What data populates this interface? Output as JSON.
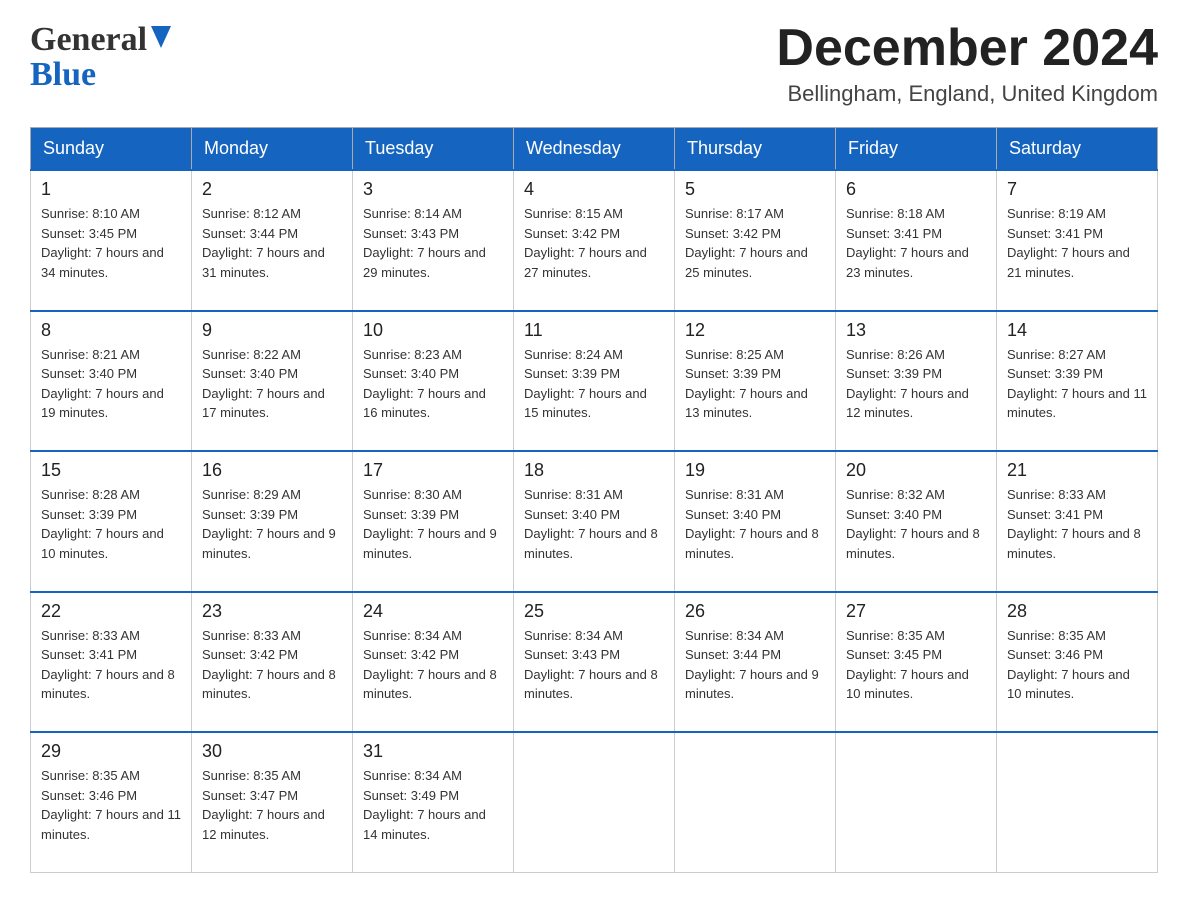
{
  "header": {
    "logo_line1": "General",
    "logo_line2": "Blue",
    "month_title": "December 2024",
    "location": "Bellingham, England, United Kingdom"
  },
  "weekdays": [
    "Sunday",
    "Monday",
    "Tuesday",
    "Wednesday",
    "Thursday",
    "Friday",
    "Saturday"
  ],
  "weeks": [
    [
      {
        "day": "1",
        "sunrise": "8:10 AM",
        "sunset": "3:45 PM",
        "daylight": "7 hours and 34 minutes."
      },
      {
        "day": "2",
        "sunrise": "8:12 AM",
        "sunset": "3:44 PM",
        "daylight": "7 hours and 31 minutes."
      },
      {
        "day": "3",
        "sunrise": "8:14 AM",
        "sunset": "3:43 PM",
        "daylight": "7 hours and 29 minutes."
      },
      {
        "day": "4",
        "sunrise": "8:15 AM",
        "sunset": "3:42 PM",
        "daylight": "7 hours and 27 minutes."
      },
      {
        "day": "5",
        "sunrise": "8:17 AM",
        "sunset": "3:42 PM",
        "daylight": "7 hours and 25 minutes."
      },
      {
        "day": "6",
        "sunrise": "8:18 AM",
        "sunset": "3:41 PM",
        "daylight": "7 hours and 23 minutes."
      },
      {
        "day": "7",
        "sunrise": "8:19 AM",
        "sunset": "3:41 PM",
        "daylight": "7 hours and 21 minutes."
      }
    ],
    [
      {
        "day": "8",
        "sunrise": "8:21 AM",
        "sunset": "3:40 PM",
        "daylight": "7 hours and 19 minutes."
      },
      {
        "day": "9",
        "sunrise": "8:22 AM",
        "sunset": "3:40 PM",
        "daylight": "7 hours and 17 minutes."
      },
      {
        "day": "10",
        "sunrise": "8:23 AM",
        "sunset": "3:40 PM",
        "daylight": "7 hours and 16 minutes."
      },
      {
        "day": "11",
        "sunrise": "8:24 AM",
        "sunset": "3:39 PM",
        "daylight": "7 hours and 15 minutes."
      },
      {
        "day": "12",
        "sunrise": "8:25 AM",
        "sunset": "3:39 PM",
        "daylight": "7 hours and 13 minutes."
      },
      {
        "day": "13",
        "sunrise": "8:26 AM",
        "sunset": "3:39 PM",
        "daylight": "7 hours and 12 minutes."
      },
      {
        "day": "14",
        "sunrise": "8:27 AM",
        "sunset": "3:39 PM",
        "daylight": "7 hours and 11 minutes."
      }
    ],
    [
      {
        "day": "15",
        "sunrise": "8:28 AM",
        "sunset": "3:39 PM",
        "daylight": "7 hours and 10 minutes."
      },
      {
        "day": "16",
        "sunrise": "8:29 AM",
        "sunset": "3:39 PM",
        "daylight": "7 hours and 9 minutes."
      },
      {
        "day": "17",
        "sunrise": "8:30 AM",
        "sunset": "3:39 PM",
        "daylight": "7 hours and 9 minutes."
      },
      {
        "day": "18",
        "sunrise": "8:31 AM",
        "sunset": "3:40 PM",
        "daylight": "7 hours and 8 minutes."
      },
      {
        "day": "19",
        "sunrise": "8:31 AM",
        "sunset": "3:40 PM",
        "daylight": "7 hours and 8 minutes."
      },
      {
        "day": "20",
        "sunrise": "8:32 AM",
        "sunset": "3:40 PM",
        "daylight": "7 hours and 8 minutes."
      },
      {
        "day": "21",
        "sunrise": "8:33 AM",
        "sunset": "3:41 PM",
        "daylight": "7 hours and 8 minutes."
      }
    ],
    [
      {
        "day": "22",
        "sunrise": "8:33 AM",
        "sunset": "3:41 PM",
        "daylight": "7 hours and 8 minutes."
      },
      {
        "day": "23",
        "sunrise": "8:33 AM",
        "sunset": "3:42 PM",
        "daylight": "7 hours and 8 minutes."
      },
      {
        "day": "24",
        "sunrise": "8:34 AM",
        "sunset": "3:42 PM",
        "daylight": "7 hours and 8 minutes."
      },
      {
        "day": "25",
        "sunrise": "8:34 AM",
        "sunset": "3:43 PM",
        "daylight": "7 hours and 8 minutes."
      },
      {
        "day": "26",
        "sunrise": "8:34 AM",
        "sunset": "3:44 PM",
        "daylight": "7 hours and 9 minutes."
      },
      {
        "day": "27",
        "sunrise": "8:35 AM",
        "sunset": "3:45 PM",
        "daylight": "7 hours and 10 minutes."
      },
      {
        "day": "28",
        "sunrise": "8:35 AM",
        "sunset": "3:46 PM",
        "daylight": "7 hours and 10 minutes."
      }
    ],
    [
      {
        "day": "29",
        "sunrise": "8:35 AM",
        "sunset": "3:46 PM",
        "daylight": "7 hours and 11 minutes."
      },
      {
        "day": "30",
        "sunrise": "8:35 AM",
        "sunset": "3:47 PM",
        "daylight": "7 hours and 12 minutes."
      },
      {
        "day": "31",
        "sunrise": "8:34 AM",
        "sunset": "3:49 PM",
        "daylight": "7 hours and 14 minutes."
      },
      null,
      null,
      null,
      null
    ]
  ]
}
